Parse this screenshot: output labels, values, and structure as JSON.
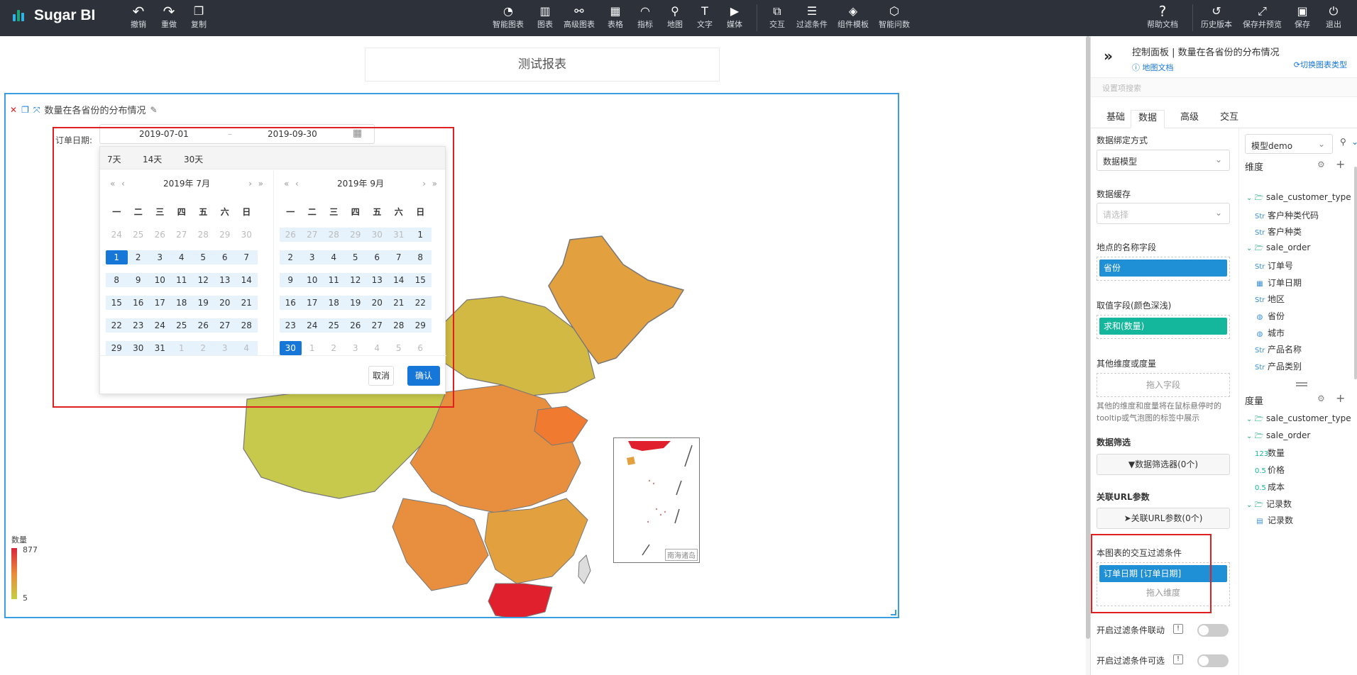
{
  "app": {
    "name": "Sugar BI"
  },
  "toolbar": {
    "left": [
      {
        "label": "撤销",
        "icon": "undo-icon"
      },
      {
        "label": "重做",
        "icon": "redo-icon"
      },
      {
        "label": "复制",
        "icon": "copy-icon"
      }
    ],
    "center": [
      {
        "label": "智能图表",
        "icon": "smart-chart-icon"
      },
      {
        "label": "图表",
        "icon": "bar-chart-icon"
      },
      {
        "label": "高级图表",
        "icon": "advanced-chart-icon"
      },
      {
        "label": "表格",
        "icon": "table-icon"
      },
      {
        "label": "指标",
        "icon": "gauge-icon"
      },
      {
        "label": "地图",
        "icon": "map-pin-icon"
      },
      {
        "label": "文字",
        "icon": "text-icon"
      },
      {
        "label": "媒体",
        "icon": "media-icon"
      },
      {
        "label": "交互",
        "icon": "interaction-icon"
      },
      {
        "label": "过滤条件",
        "icon": "filter-icon"
      },
      {
        "label": "组件模板",
        "icon": "template-icon"
      },
      {
        "label": "智能问数",
        "icon": "smart-query-icon"
      }
    ],
    "right": [
      {
        "label": "帮助文档",
        "icon": "help-icon"
      },
      {
        "label": "历史版本",
        "icon": "history-icon"
      },
      {
        "label": "保存并预览",
        "icon": "expand-icon"
      },
      {
        "label": "保存",
        "icon": "save-icon"
      },
      {
        "label": "退出",
        "icon": "exit-icon"
      }
    ]
  },
  "report": {
    "title": "测试报表"
  },
  "widget": {
    "title": "数量在各省份的分布情况",
    "filter_label": "订单日期:",
    "date_start": "2019-07-01",
    "date_sep": "–",
    "date_end": "2019-09-30",
    "quick": [
      "7天",
      "14天",
      "30天"
    ],
    "left_month": "2019年 7月",
    "right_month": "2019年 9月",
    "weekdays": [
      "一",
      "二",
      "三",
      "四",
      "五",
      "六",
      "日"
    ],
    "cancel": "取消",
    "confirm": "确认",
    "legend_title": "数量",
    "legend_max": "877",
    "legend_min": "5",
    "inset_label": "南海诸岛"
  },
  "panel": {
    "title": "控制面板 | 数量在各省份的分布情况",
    "doc_link": "地图文档",
    "switch_link": "切换图表类型",
    "search_placeholder": "设置项搜索",
    "tabs": [
      "基础",
      "数据",
      "高级",
      "交互"
    ],
    "binding_label": "数据绑定方式",
    "binding_value": "数据模型",
    "cache_label": "数据缓存",
    "cache_placeholder": "请选择",
    "location_label": "地点的名称字段",
    "location_field": "省份",
    "value_label": "取值字段(颜色深浅)",
    "value_field": "求和(数量)",
    "other_label": "其他维度或度量",
    "other_drop": "拖入字段",
    "other_note": "其他的维度和度量将在鼠标悬停时的tooltip或气泡图的标签中展示",
    "filter_section": "数据筛选",
    "filter_button": "数据筛选器(0个)",
    "url_section": "关联URL参数",
    "url_button": "关联URL参数(0个)",
    "interactive_label": "本图表的交互过滤条件",
    "interactive_field": "订单日期 [订单日期]",
    "interactive_drop": "拖入维度",
    "toggle1": "开启过滤条件联动",
    "toggle2": "开启过滤条件可选",
    "model": "模型demo",
    "dimensions_title": "维度",
    "dimensions": [
      {
        "name": "sale_customer_type",
        "type": "folder"
      },
      {
        "name": "客户种类代码",
        "type": "Str"
      },
      {
        "name": "客户种类",
        "type": "Str"
      },
      {
        "name": "sale_order",
        "type": "folder"
      },
      {
        "name": "订单号",
        "type": "Str"
      },
      {
        "name": "订单日期",
        "type": "date"
      },
      {
        "name": "地区",
        "type": "Str"
      },
      {
        "name": "省份",
        "type": "geo"
      },
      {
        "name": "城市",
        "type": "geo"
      },
      {
        "name": "产品名称",
        "type": "Str"
      },
      {
        "name": "产品类别",
        "type": "Str"
      }
    ],
    "measures_title": "度量",
    "measures": [
      {
        "name": "sale_customer_type",
        "type": "folder"
      },
      {
        "name": "sale_order",
        "type": "folder"
      },
      {
        "name": "数量",
        "type": "123"
      },
      {
        "name": "价格",
        "type": "0.5"
      },
      {
        "name": "成本",
        "type": "0.5"
      },
      {
        "name": "记录数",
        "type": "folder"
      },
      {
        "name": "记录数",
        "type": "rec"
      }
    ]
  },
  "colors": {
    "accent": "#1677d9",
    "highlight": "#e02020",
    "topbar": "#2c313a",
    "teal": "#14b79b"
  }
}
